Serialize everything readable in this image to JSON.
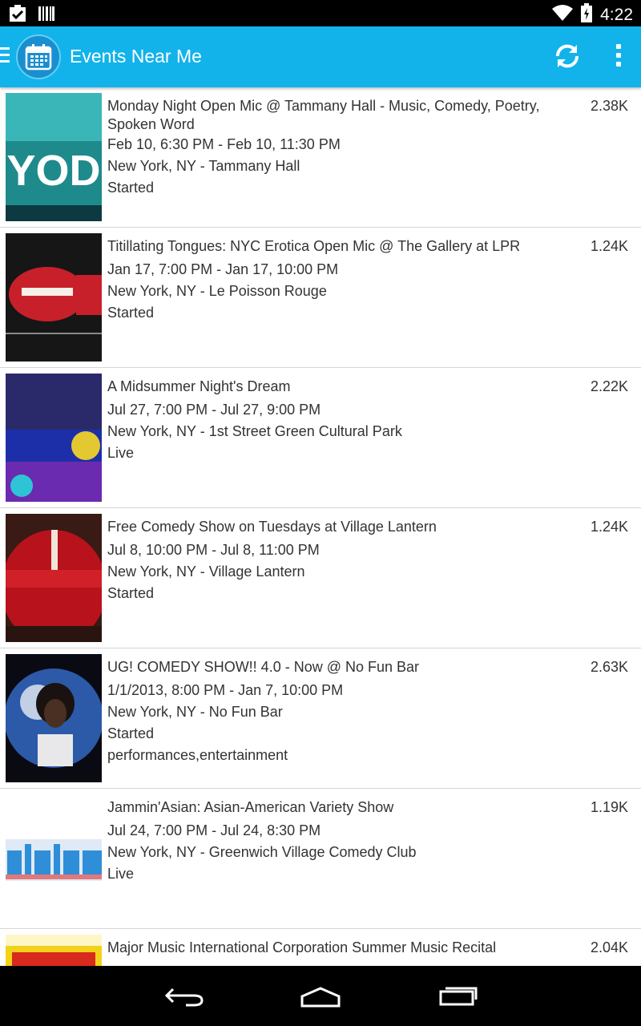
{
  "status_bar": {
    "time": "4:22"
  },
  "app_bar": {
    "title": "Events Near Me"
  },
  "events": [
    {
      "title": "Monday Night Open Mic @ Tammany Hall - Music, Comedy, Poetry, Spoken Word",
      "date": "Feb 10, 6:30 PM - Feb 10, 11:30 PM",
      "location": "New York, NY - Tammany Hall",
      "status": "Started",
      "tags": "",
      "count": "2.38K"
    },
    {
      "title": "Titillating Tongues: NYC Erotica Open Mic @ The Gallery at LPR",
      "date": "Jan 17, 7:00 PM - Jan 17, 10:00 PM",
      "location": "New York, NY - Le Poisson Rouge",
      "status": "Started",
      "tags": "",
      "count": "1.24K"
    },
    {
      "title": "A Midsummer Night's Dream",
      "date": "Jul 27, 7:00 PM - Jul 27, 9:00 PM",
      "location": "New York, NY - 1st Street Green Cultural Park",
      "status": "Live",
      "tags": "",
      "count": "2.22K"
    },
    {
      "title": "Free Comedy Show on Tuesdays at Village Lantern",
      "date": "Jul 8, 10:00 PM - Jul 8, 11:00 PM",
      "location": "New York, NY - Village Lantern",
      "status": "Started",
      "tags": "",
      "count": "1.24K"
    },
    {
      "title": "UG! COMEDY SHOW!! 4.0 - Now @ No Fun Bar",
      "date": "1/1/2013, 8:00 PM - Jan 7, 10:00 PM",
      "location": "New York, NY - No Fun Bar",
      "status": "Started",
      "tags": "performances,entertainment",
      "count": "2.63K"
    },
    {
      "title": "Jammin'Asian: Asian-American Variety Show",
      "date": "Jul 24, 7:00 PM - Jul 24, 8:30 PM",
      "location": "New York, NY - Greenwich Village Comedy Club",
      "status": "Live",
      "tags": "",
      "count": "1.19K"
    },
    {
      "title": "Major Music International Corporation Summer Music Recital",
      "date": "",
      "location": "",
      "status": "",
      "tags": "",
      "count": "2.04K"
    }
  ]
}
